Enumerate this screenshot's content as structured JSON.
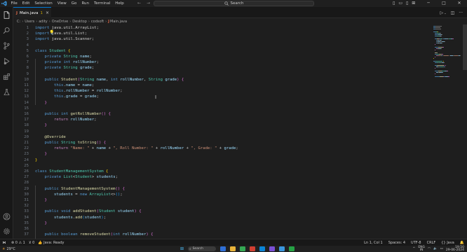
{
  "menu": [
    "File",
    "Edit",
    "Selection",
    "View",
    "Go",
    "Run",
    "Terminal",
    "Help"
  ],
  "search": {
    "label": "Search"
  },
  "tab": {
    "label": "Main.java",
    "badge": "1"
  },
  "breadcrumb": [
    "C:",
    "Users",
    "adity",
    "OneDrive",
    "Desktop",
    "codsoft",
    "Main.java"
  ],
  "editor": {
    "lines": [
      {
        "n": "1",
        "tokens": [
          [
            "k",
            "import "
          ],
          [
            "p",
            "java.util.ArrayList;"
          ]
        ]
      },
      {
        "n": "2",
        "tokens": [
          [
            "k",
            "import "
          ],
          [
            "p",
            "java.util.List;"
          ]
        ]
      },
      {
        "n": "3",
        "tokens": [
          [
            "k",
            "import "
          ],
          [
            "p",
            "java.util.Scanner;"
          ]
        ]
      },
      {
        "n": "4",
        "tokens": []
      },
      {
        "n": "5",
        "tokens": [
          [
            "k",
            "class "
          ],
          [
            "t",
            "Student "
          ],
          [
            "b1",
            "{"
          ]
        ]
      },
      {
        "n": "6",
        "tokens": [
          [
            "p",
            "    "
          ],
          [
            "k",
            "private "
          ],
          [
            "t",
            "String "
          ],
          [
            "v",
            "name"
          ],
          [
            "p",
            ";"
          ]
        ]
      },
      {
        "n": "7",
        "tokens": [
          [
            "p",
            "    "
          ],
          [
            "k",
            "private "
          ],
          [
            "k",
            "int "
          ],
          [
            "v",
            "rollNumber"
          ],
          [
            "p",
            ";"
          ]
        ]
      },
      {
        "n": "8",
        "tokens": [
          [
            "p",
            "    "
          ],
          [
            "k",
            "private "
          ],
          [
            "t",
            "String "
          ],
          [
            "v",
            "grade"
          ],
          [
            "p",
            ";"
          ]
        ]
      },
      {
        "n": "9",
        "tokens": []
      },
      {
        "n": "10",
        "tokens": [
          [
            "p",
            "    "
          ],
          [
            "k",
            "public "
          ],
          [
            "f",
            "Student"
          ],
          [
            "b2",
            "("
          ],
          [
            "t",
            "String "
          ],
          [
            "v",
            "name"
          ],
          [
            "p",
            ", "
          ],
          [
            "k",
            "int "
          ],
          [
            "v",
            "rollNumber"
          ],
          [
            "p",
            ", "
          ],
          [
            "t",
            "String "
          ],
          [
            "v",
            "grade"
          ],
          [
            "b2",
            ")"
          ],
          [
            "p",
            " "
          ],
          [
            "b2",
            "{"
          ]
        ]
      },
      {
        "n": "11",
        "tokens": [
          [
            "p",
            "        "
          ],
          [
            "k",
            "this"
          ],
          [
            "p",
            "."
          ],
          [
            "v",
            "name"
          ],
          [
            "p",
            " = "
          ],
          [
            "v",
            "name"
          ],
          [
            "p",
            ";"
          ]
        ]
      },
      {
        "n": "12",
        "tokens": [
          [
            "p",
            "        "
          ],
          [
            "k",
            "this"
          ],
          [
            "p",
            "."
          ],
          [
            "v",
            "rollNumber"
          ],
          [
            "p",
            " = "
          ],
          [
            "v",
            "rollNumber"
          ],
          [
            "p",
            ";"
          ]
        ]
      },
      {
        "n": "13",
        "tokens": [
          [
            "p",
            "        "
          ],
          [
            "k",
            "this"
          ],
          [
            "p",
            "."
          ],
          [
            "v",
            "grade"
          ],
          [
            "p",
            " = "
          ],
          [
            "v",
            "grade"
          ],
          [
            "p",
            ";"
          ]
        ]
      },
      {
        "n": "14",
        "tokens": [
          [
            "p",
            "    "
          ],
          [
            "b2",
            "}"
          ]
        ]
      },
      {
        "n": "15",
        "tokens": []
      },
      {
        "n": "16",
        "tokens": [
          [
            "p",
            "    "
          ],
          [
            "k",
            "public "
          ],
          [
            "k",
            "int "
          ],
          [
            "f",
            "getRollNumber"
          ],
          [
            "b2",
            "()"
          ],
          [
            "p",
            " "
          ],
          [
            "b2",
            "{"
          ]
        ]
      },
      {
        "n": "17",
        "tokens": [
          [
            "p",
            "        "
          ],
          [
            "ctl",
            "return "
          ],
          [
            "v",
            "rollNumber"
          ],
          [
            "p",
            ";"
          ]
        ]
      },
      {
        "n": "18",
        "tokens": [
          [
            "p",
            "    "
          ],
          [
            "b2",
            "}"
          ]
        ]
      },
      {
        "n": "19",
        "tokens": []
      },
      {
        "n": "20",
        "tokens": [
          [
            "p",
            "    "
          ],
          [
            "a",
            "@Override"
          ]
        ]
      },
      {
        "n": "21",
        "tokens": [
          [
            "p",
            "    "
          ],
          [
            "k",
            "public "
          ],
          [
            "t",
            "String "
          ],
          [
            "f",
            "toString"
          ],
          [
            "b2",
            "()"
          ],
          [
            "p",
            " "
          ],
          [
            "b2",
            "{"
          ]
        ]
      },
      {
        "n": "22",
        "tokens": [
          [
            "p",
            "        "
          ],
          [
            "ctl",
            "return "
          ],
          [
            "s",
            "\"Name: \""
          ],
          [
            "p",
            " + "
          ],
          [
            "v",
            "name"
          ],
          [
            "p",
            " + "
          ],
          [
            "s",
            "\", Roll Number: \""
          ],
          [
            "p",
            " + "
          ],
          [
            "v",
            "rollNumber"
          ],
          [
            "p",
            " + "
          ],
          [
            "s",
            "\", Grade: \""
          ],
          [
            "p",
            " + "
          ],
          [
            "v",
            "grade"
          ],
          [
            "p",
            ";"
          ]
        ]
      },
      {
        "n": "23",
        "tokens": [
          [
            "p",
            "    "
          ],
          [
            "b2",
            "}"
          ]
        ]
      },
      {
        "n": "24",
        "tokens": [
          [
            "b1",
            "}"
          ]
        ]
      },
      {
        "n": "25",
        "tokens": []
      },
      {
        "n": "26",
        "tokens": [
          [
            "k",
            "class "
          ],
          [
            "t",
            "StudentManagementSystem "
          ],
          [
            "b1",
            "{"
          ]
        ]
      },
      {
        "n": "27",
        "tokens": [
          [
            "p",
            "    "
          ],
          [
            "k",
            "private "
          ],
          [
            "t",
            "List"
          ],
          [
            "p",
            "<"
          ],
          [
            "t",
            "Student"
          ],
          [
            "p",
            "> "
          ],
          [
            "v",
            "students"
          ],
          [
            "p",
            ";"
          ]
        ]
      },
      {
        "n": "28",
        "tokens": []
      },
      {
        "n": "29",
        "tokens": [
          [
            "p",
            "    "
          ],
          [
            "k",
            "public "
          ],
          [
            "f",
            "StudentManagementSystem"
          ],
          [
            "b2",
            "()"
          ],
          [
            "p",
            " "
          ],
          [
            "b2",
            "{"
          ]
        ]
      },
      {
        "n": "30",
        "tokens": [
          [
            "p",
            "        "
          ],
          [
            "v",
            "students"
          ],
          [
            "p",
            " = "
          ],
          [
            "k",
            "new "
          ],
          [
            "t",
            "ArrayList"
          ],
          [
            "p",
            "<>"
          ],
          [
            "b3",
            "()"
          ],
          [
            "p",
            ";"
          ]
        ]
      },
      {
        "n": "31",
        "tokens": [
          [
            "p",
            "    "
          ],
          [
            "b2",
            "}"
          ]
        ]
      },
      {
        "n": "32",
        "tokens": []
      },
      {
        "n": "33",
        "tokens": [
          [
            "p",
            "    "
          ],
          [
            "k",
            "public "
          ],
          [
            "k",
            "void "
          ],
          [
            "f",
            "addStudent"
          ],
          [
            "b2",
            "("
          ],
          [
            "t",
            "Student "
          ],
          [
            "v",
            "student"
          ],
          [
            "b2",
            ")"
          ],
          [
            "p",
            " "
          ],
          [
            "b2",
            "{"
          ]
        ]
      },
      {
        "n": "34",
        "tokens": [
          [
            "p",
            "        "
          ],
          [
            "v",
            "students"
          ],
          [
            "p",
            "."
          ],
          [
            "f",
            "add"
          ],
          [
            "b3",
            "("
          ],
          [
            "v",
            "student"
          ],
          [
            "b3",
            ")"
          ],
          [
            "p",
            ";"
          ]
        ]
      },
      {
        "n": "35",
        "tokens": [
          [
            "p",
            "    "
          ],
          [
            "b2",
            "}"
          ]
        ]
      },
      {
        "n": "36",
        "tokens": []
      },
      {
        "n": "37",
        "tokens": [
          [
            "p",
            "    "
          ],
          [
            "k",
            "public "
          ],
          [
            "k",
            "boolean "
          ],
          [
            "f",
            "removeStudent"
          ],
          [
            "b2",
            "("
          ],
          [
            "k",
            "int "
          ],
          [
            "v",
            "rollNumber"
          ],
          [
            "b2",
            ")"
          ],
          [
            "p",
            " "
          ],
          [
            "b2",
            "{"
          ]
        ]
      }
    ]
  },
  "statusbar": {
    "errors": "0",
    "warnings": "1",
    "ports": "0",
    "java_status": "Java: Ready",
    "position": "Ln 1, Col 1",
    "spaces": "Spaces: 4",
    "encoding": "UTF-8",
    "eol": "CRLF",
    "language": "Java"
  },
  "taskbar": {
    "temperature": "29°C",
    "search": "Search",
    "lang": "ENG",
    "region": "IN",
    "time": "19:50",
    "date": "29-06-2024"
  },
  "colors": {
    "accent": "#0078d4",
    "java_icon": "#e06c4a"
  }
}
